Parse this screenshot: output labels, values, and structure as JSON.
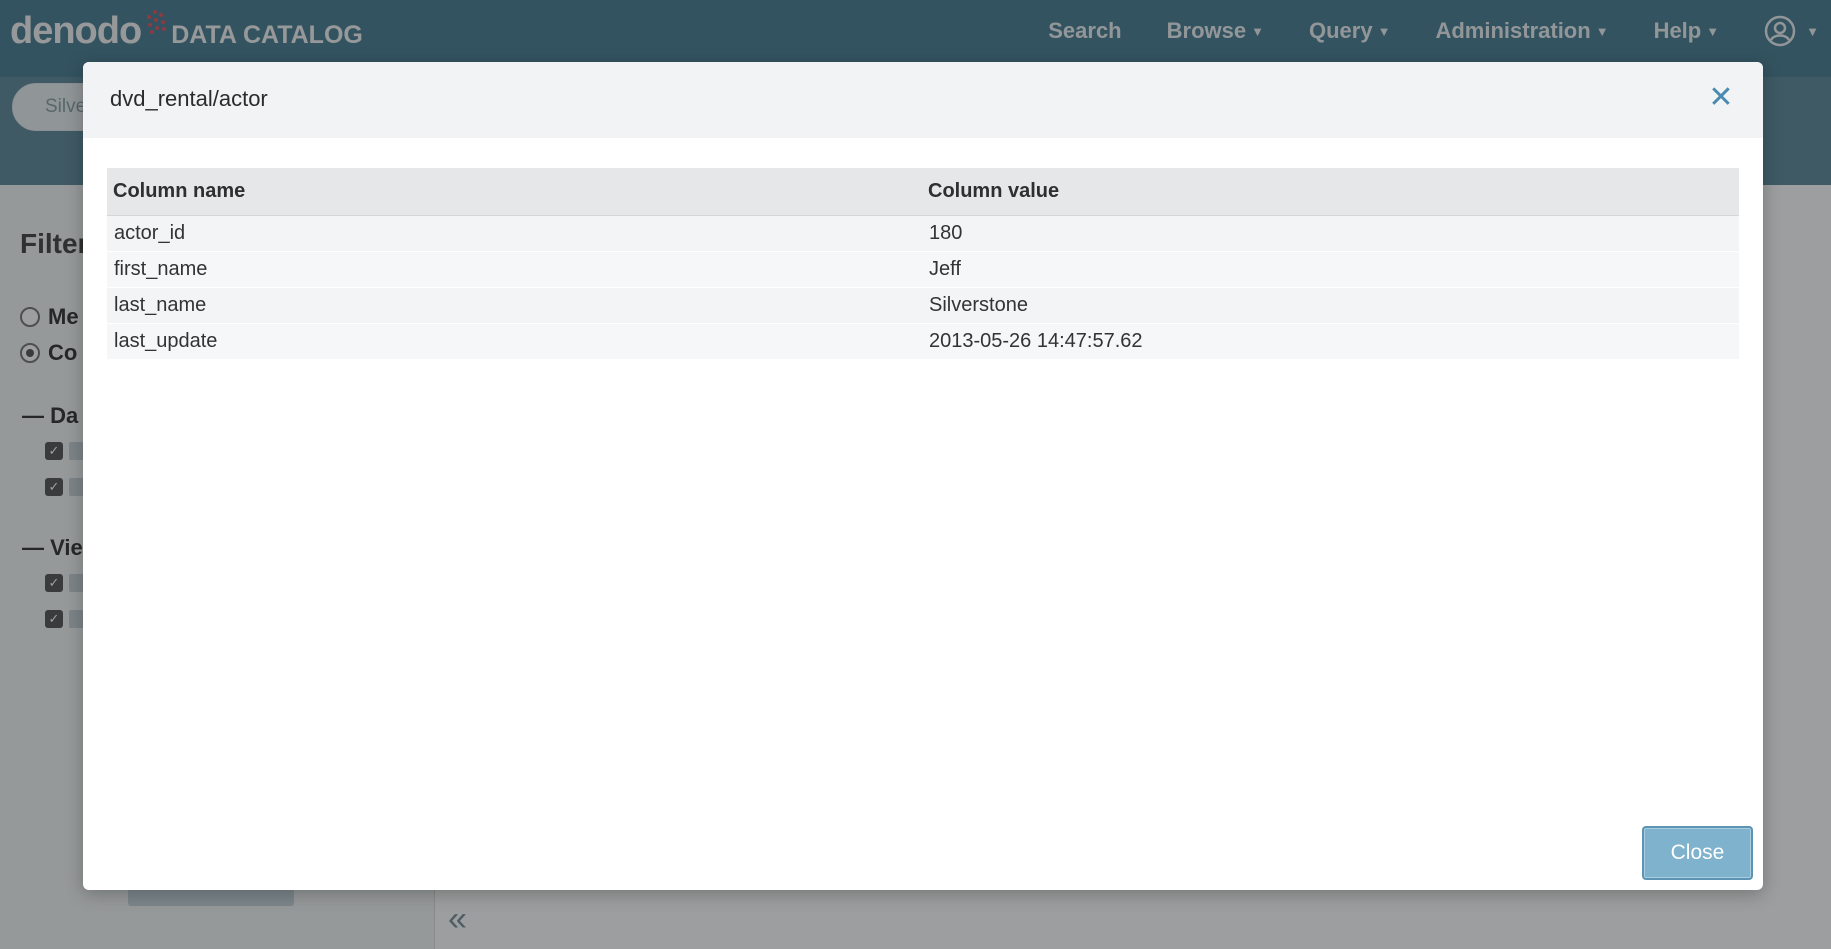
{
  "app": {
    "logo_word": "denodo",
    "logo_sub": "DATA CATALOG",
    "nav": [
      {
        "label": "Search",
        "has_caret": false
      },
      {
        "label": "Browse",
        "has_caret": true
      },
      {
        "label": "Query",
        "has_caret": true
      },
      {
        "label": "Administration",
        "has_caret": true
      },
      {
        "label": "Help",
        "has_caret": true
      }
    ],
    "search_value": "Silve",
    "filters_title": "Filter",
    "radio_1": "Me",
    "radio_2": "Co",
    "section_1": "Da",
    "section_2": "Vie",
    "collapse_glyph": "«"
  },
  "modal": {
    "title": "dvd_rental/actor",
    "close_glyph": "✕",
    "columns": {
      "name": "Column name",
      "value": "Column value"
    },
    "rows": [
      {
        "name": "actor_id",
        "value": "180"
      },
      {
        "name": "first_name",
        "value": "Jeff"
      },
      {
        "name": "last_name",
        "value": "Silverstone"
      },
      {
        "name": "last_update",
        "value": "2013-05-26 14:47:57.62"
      }
    ],
    "close_label": "Close"
  },
  "colors": {
    "topbar": "#4a7f93",
    "accent": "#7fb2cd",
    "close_x": "#4a8ab0",
    "logo_dots": "#e25563"
  }
}
